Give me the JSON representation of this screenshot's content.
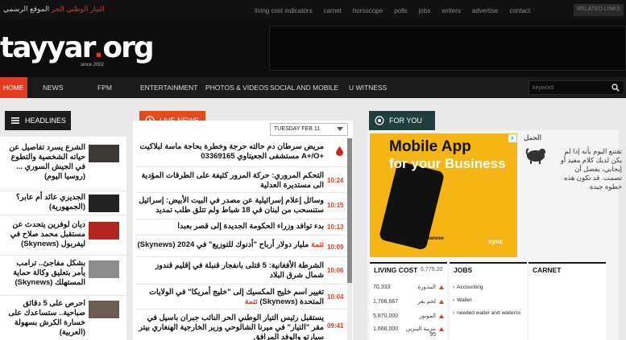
{
  "topbar": {
    "site_tag_red": "التيار الوطني الحر",
    "site_tag_rest": "الموقع الرسمي",
    "links": [
      "living cost indicators",
      "carnet",
      "horoscope",
      "polls",
      "jobs",
      "writers",
      "advertise",
      "contact"
    ],
    "related_links": "RELATED LINKS"
  },
  "header": {
    "logo_main": "tayyar",
    "logo_dot": ".",
    "logo_org": "org",
    "logo_since": "since 2002"
  },
  "nav": {
    "items": [
      "HOME",
      "NEWS",
      "FPM",
      "ENTERTAINMENT",
      "PHOTOS & VIDEOS",
      "SOCIAL AND MOBILE",
      "U WITNESS"
    ],
    "active": "HOME",
    "search_placeholder": "keyword"
  },
  "headlines": {
    "title": "HEADLINES",
    "items": [
      {
        "text": "الشرع يسرد تفاصيل عن حياته الشخصية والتطوع في الجيش السوري ... (روسيا اليوم)"
      },
      {
        "text": "الجديري عائد أم عابر؟ (الجمهورية)"
      },
      {
        "text": "ديان لوفرين يتحدث عن مستقبل محمد صلاح في ليفربول (Skynews)"
      },
      {
        "text": "بشكل مفاجئ.. ترامب يأمر بتعليق وكالة حماية المستهلك (Skynews)"
      },
      {
        "text": "احرص على 5 دقائق صباحية.. ستساعدك على خسارة الكرش بسهولة (العربية)"
      }
    ]
  },
  "live_news": {
    "title": "LIVE NEWS",
    "date_selected": "TUESDAY FEB 11",
    "items": [
      {
        "text": "مريض سرطان دم حالته حرجة وخطرة بحاجة ماسة  لبلاكيت +A+/O  مستشفى الجعيتاوي  03369165",
        "time": ""
      },
      {
        "text": "التحكم المروري: حركة المرور كثيفة على الطرقات المؤدية الى مستديرة العدلية",
        "time": "10:24"
      },
      {
        "text": "وسائل إعلام إسرائيلية عن مصدر في البيت الأبيض: إسرائيل ستنسحب من لبنان في 18 شباط ولم تتلق طلب تمديد",
        "time": "10:15"
      },
      {
        "text": "بدء توافد وزراء الحكومة الجديدة إلى قصر بعبدا",
        "time": "10:13"
      },
      {
        "text": "مليار دولار أرباح \"أدنوك للتوزيع\" في 2024 (Skynews)",
        "highlight": "تتمة",
        "time": "10:09"
      },
      {
        "text": "الشرطة الأفغانية: 5 قتلى بانفجار قنبلة في إقليم قندوز شمال شرق البلاد",
        "time": "10:06"
      },
      {
        "text": "تغيير اسم خليج المكسيك إلى \"خليج أمريكا\" في الولايات المتحدة (Skynews)",
        "highlight": "تتمة",
        "time": "10:04"
      },
      {
        "text": "يستقبل رئيس التيار الوطني الحر النائب جبران باسيل في مقر \"التيار\" في ميرنا الشالوحي وزير الخارجية الهنغاري بيتر سيارتو والوفد المرافق",
        "time": "09:41"
      }
    ]
  },
  "for_you": {
    "title": "FOR YOU",
    "ad": {
      "line1": "Mobile App",
      "line2": "for your Business",
      "brand": "Proudly Lebanese",
      "sync": "sync",
      "close": "x"
    },
    "horoscope": {
      "sign": "الحمل",
      "text": "تقتنع اليوم بأنه إذا لم يكن لديك كلام مفيد أو إيجابي، يفضل أن تصمت. قد تكون هذه خطوة جيدة"
    }
  },
  "living_cost": {
    "title": "LIVING COST",
    "top_value": "6,779.20",
    "rows": [
      {
        "value": "70,333",
        "name": "البندورة"
      },
      {
        "value": "1,766,667",
        "name": "لحم بقر"
      },
      {
        "value": "5,870,000",
        "name": "المونور"
      },
      {
        "value": "1,668,000",
        "name": "بنزينة البنزين 95"
      }
    ]
  },
  "jobs": {
    "title": "JOBS",
    "items": [
      "Accounting",
      "Waiter",
      "needed waiter and waiterss"
    ]
  },
  "carnet": {
    "title": "CARNET"
  },
  "colors": {
    "accent": "#e23b1e",
    "live": "#e34a1c",
    "foryou": "#1f3f3f",
    "ad_bg": "#f4b515"
  }
}
